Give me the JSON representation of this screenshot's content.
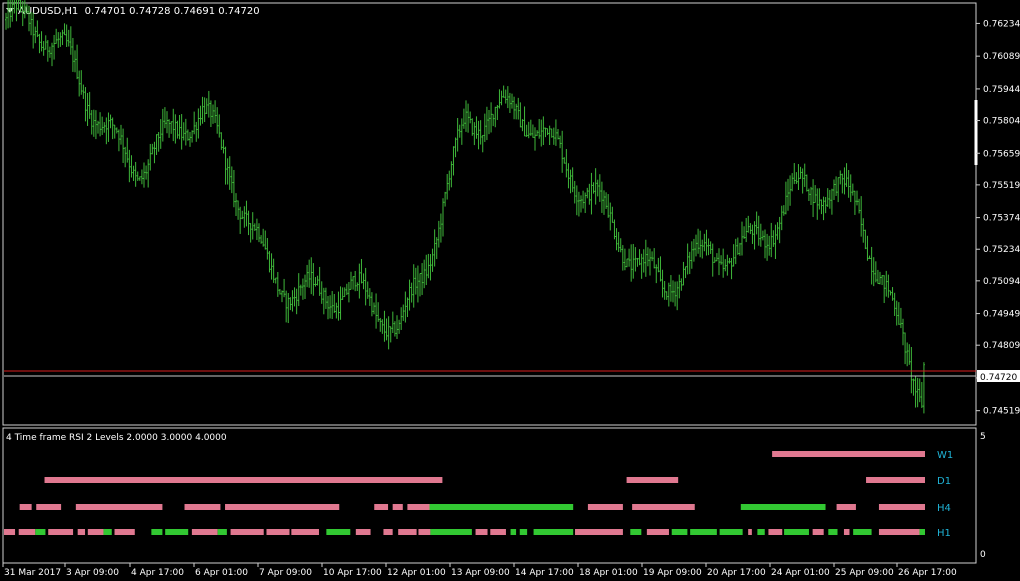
{
  "main_chart": {
    "symbol_timeframe": "AUDUSD,H1",
    "ohlc": "0.74701 0.74728 0.74691 0.74720",
    "header_text": "AUDUSD,H1  0.74701 0.74728 0.74691 0.74720",
    "current_price_label": "0.74720",
    "price_ticks": [
      "0.76234",
      "0.76089",
      "0.75944",
      "0.75804",
      "0.75659",
      "0.75519",
      "0.75374",
      "0.75234",
      "0.75094",
      "0.74949",
      "0.74809",
      "0.74664",
      "0.74519"
    ],
    "bar_color": "#3fb83a",
    "ask_line_color": "#d81e1e",
    "bid_line_color": "#c8c8c8"
  },
  "sub_window": {
    "title": "4 Time frame RSI 2 Levels 2.0000 3.0000 4.0000",
    "scale_top": "5",
    "scale_bottom": "0",
    "row_labels": [
      "W1",
      "D1",
      "H4",
      "H1"
    ],
    "color_up": "#32c832",
    "color_down": "#e07890",
    "label_color": "#1fb3d6"
  },
  "time_axis": [
    "31 Mar 2017",
    "3 Apr 09:00",
    "4 Apr 17:00",
    "6 Apr 01:00",
    "7 Apr 09:00",
    "10 Apr 17:00",
    "12 Apr 01:00",
    "13 Apr 09:00",
    "14 Apr 17:00",
    "18 Apr 01:00",
    "19 Apr 09:00",
    "20 Apr 17:00",
    "24 Apr 01:00",
    "25 Apr 09:00",
    "26 Apr 17:00"
  ],
  "chart_data": {
    "type": "line",
    "title": "AUDUSD,H1",
    "series": [
      {
        "name": "AUDUSD,H1",
        "x": [
          "31 Mar 2017",
          "3 Apr 09:00",
          "4 Apr 17:00",
          "6 Apr 01:00",
          "7 Apr 09:00",
          "10 Apr 17:00",
          "12 Apr 01:00",
          "13 Apr 09:00",
          "14 Apr 17:00",
          "18 Apr 01:00",
          "19 Apr 09:00",
          "20 Apr 17:00",
          "24 Apr 01:00",
          "25 Apr 09:00",
          "26 Apr 17:00"
        ],
        "values": [
          0.7625,
          0.76,
          0.7568,
          0.7575,
          0.7522,
          0.75,
          0.7485,
          0.7585,
          0.7572,
          0.7555,
          0.7498,
          0.7525,
          0.755,
          0.7535,
          0.7468
        ]
      }
    ],
    "ylim": [
      0.7446,
      0.7632
    ],
    "last": 0.7472,
    "ohlc": {
      "open": 0.74701,
      "high": 0.74728,
      "low": 0.74691,
      "close": 0.7472
    },
    "grid": false,
    "rsi_levels": [
      2.0,
      3.0,
      4.0
    ],
    "rsi_rows": {
      "W1": [
        {
          "from": 0.834,
          "to": 1.0,
          "state": "down"
        }
      ],
      "D1": [
        {
          "from": 0.044,
          "to": 0.476,
          "state": "down"
        },
        {
          "from": 0.676,
          "to": 0.732,
          "state": "down"
        },
        {
          "from": 0.936,
          "to": 1.0,
          "state": "down"
        }
      ],
      "H4": [
        {
          "from": 0.017,
          "to": 0.03,
          "state": "down"
        },
        {
          "from": 0.035,
          "to": 0.062,
          "state": "down"
        },
        {
          "from": 0.078,
          "to": 0.172,
          "state": "down"
        },
        {
          "from": 0.196,
          "to": 0.235,
          "state": "down"
        },
        {
          "from": 0.24,
          "to": 0.364,
          "state": "down"
        },
        {
          "from": 0.402,
          "to": 0.417,
          "state": "down"
        },
        {
          "from": 0.422,
          "to": 0.433,
          "state": "down"
        },
        {
          "from": 0.438,
          "to": 0.462,
          "state": "down"
        },
        {
          "from": 0.462,
          "to": 0.618,
          "state": "up"
        },
        {
          "from": 0.634,
          "to": 0.672,
          "state": "down"
        },
        {
          "from": 0.682,
          "to": 0.75,
          "state": "down"
        },
        {
          "from": 0.8,
          "to": 0.892,
          "state": "up"
        },
        {
          "from": 0.904,
          "to": 0.925,
          "state": "down"
        },
        {
          "from": 0.95,
          "to": 1.0,
          "state": "down"
        }
      ],
      "H1": [
        {
          "from": 0.0,
          "to": 0.012,
          "state": "down"
        },
        {
          "from": 0.016,
          "to": 0.034,
          "state": "down"
        },
        {
          "from": 0.034,
          "to": 0.045,
          "state": "up"
        },
        {
          "from": 0.048,
          "to": 0.075,
          "state": "down"
        },
        {
          "from": 0.08,
          "to": 0.088,
          "state": "down"
        },
        {
          "from": 0.091,
          "to": 0.108,
          "state": "down"
        },
        {
          "from": 0.108,
          "to": 0.117,
          "state": "up"
        },
        {
          "from": 0.12,
          "to": 0.142,
          "state": "down"
        },
        {
          "from": 0.16,
          "to": 0.172,
          "state": "up"
        },
        {
          "from": 0.175,
          "to": 0.2,
          "state": "up"
        },
        {
          "from": 0.204,
          "to": 0.232,
          "state": "down"
        },
        {
          "from": 0.232,
          "to": 0.242,
          "state": "up"
        },
        {
          "from": 0.246,
          "to": 0.282,
          "state": "down"
        },
        {
          "from": 0.285,
          "to": 0.31,
          "state": "down"
        },
        {
          "from": 0.312,
          "to": 0.342,
          "state": "down"
        },
        {
          "from": 0.35,
          "to": 0.376,
          "state": "up"
        },
        {
          "from": 0.382,
          "to": 0.398,
          "state": "down"
        },
        {
          "from": 0.412,
          "to": 0.422,
          "state": "down"
        },
        {
          "from": 0.428,
          "to": 0.448,
          "state": "down"
        },
        {
          "from": 0.45,
          "to": 0.463,
          "state": "down"
        },
        {
          "from": 0.463,
          "to": 0.508,
          "state": "up"
        },
        {
          "from": 0.512,
          "to": 0.525,
          "state": "down"
        },
        {
          "from": 0.528,
          "to": 0.545,
          "state": "down"
        },
        {
          "from": 0.55,
          "to": 0.556,
          "state": "up"
        },
        {
          "from": 0.56,
          "to": 0.568,
          "state": "up"
        },
        {
          "from": 0.575,
          "to": 0.618,
          "state": "up"
        },
        {
          "from": 0.62,
          "to": 0.672,
          "state": "down"
        },
        {
          "from": 0.68,
          "to": 0.692,
          "state": "up"
        },
        {
          "from": 0.698,
          "to": 0.722,
          "state": "down"
        },
        {
          "from": 0.725,
          "to": 0.742,
          "state": "up"
        },
        {
          "from": 0.745,
          "to": 0.774,
          "state": "up"
        },
        {
          "from": 0.777,
          "to": 0.802,
          "state": "up"
        },
        {
          "from": 0.808,
          "to": 0.812,
          "state": "down"
        },
        {
          "from": 0.818,
          "to": 0.826,
          "state": "up"
        },
        {
          "from": 0.83,
          "to": 0.845,
          "state": "down"
        },
        {
          "from": 0.847,
          "to": 0.874,
          "state": "up"
        },
        {
          "from": 0.878,
          "to": 0.89,
          "state": "down"
        },
        {
          "from": 0.895,
          "to": 0.905,
          "state": "up"
        },
        {
          "from": 0.912,
          "to": 0.918,
          "state": "down"
        },
        {
          "from": 0.922,
          "to": 0.942,
          "state": "up"
        },
        {
          "from": 0.95,
          "to": 0.994,
          "state": "down"
        },
        {
          "from": 0.994,
          "to": 1.0,
          "state": "up"
        }
      ]
    }
  }
}
